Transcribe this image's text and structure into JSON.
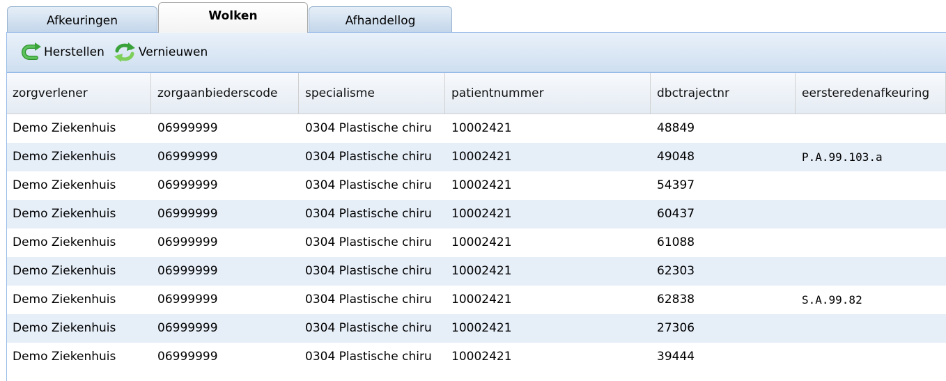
{
  "tabs": [
    {
      "label": "Afkeuringen",
      "active": false
    },
    {
      "label": "Wolken",
      "active": true
    },
    {
      "label": "Afhandellog",
      "active": false
    }
  ],
  "toolbar": {
    "restore_label": "Herstellen",
    "restore_icon": "undo-arrow-icon",
    "refresh_label": "Vernieuwen",
    "refresh_icon": "refresh-icon"
  },
  "colors": {
    "icon_green": "#3aa23a",
    "tab_blue": "#c3d6ea",
    "row_alt": "#e6eef8",
    "toolbar_border": "#99bbe8"
  },
  "grid": {
    "columns": [
      "zorgverlener",
      "zorgaanbiederscode",
      "specialisme",
      "patientnummer",
      "dbctrajectnr",
      "eersteredenafkeuring"
    ],
    "rows": [
      [
        "Demo Ziekenhuis",
        "06999999",
        "0304 Plastische chiru",
        "10002421",
        "48849",
        ""
      ],
      [
        "Demo Ziekenhuis",
        "06999999",
        "0304 Plastische chiru",
        "10002421",
        "49048",
        "P.A.99.103.a"
      ],
      [
        "Demo Ziekenhuis",
        "06999999",
        "0304 Plastische chiru",
        "10002421",
        "54397",
        ""
      ],
      [
        "Demo Ziekenhuis",
        "06999999",
        "0304 Plastische chiru",
        "10002421",
        "60437",
        ""
      ],
      [
        "Demo Ziekenhuis",
        "06999999",
        "0304 Plastische chiru",
        "10002421",
        "61088",
        ""
      ],
      [
        "Demo Ziekenhuis",
        "06999999",
        "0304 Plastische chiru",
        "10002421",
        "62303",
        ""
      ],
      [
        "Demo Ziekenhuis",
        "06999999",
        "0304 Plastische chiru",
        "10002421",
        "62838",
        "S.A.99.82"
      ],
      [
        "Demo Ziekenhuis",
        "06999999",
        "0304 Plastische chiru",
        "10002421",
        "27306",
        ""
      ],
      [
        "Demo Ziekenhuis",
        "06999999",
        "0304 Plastische chiru",
        "10002421",
        "39444",
        ""
      ]
    ]
  }
}
